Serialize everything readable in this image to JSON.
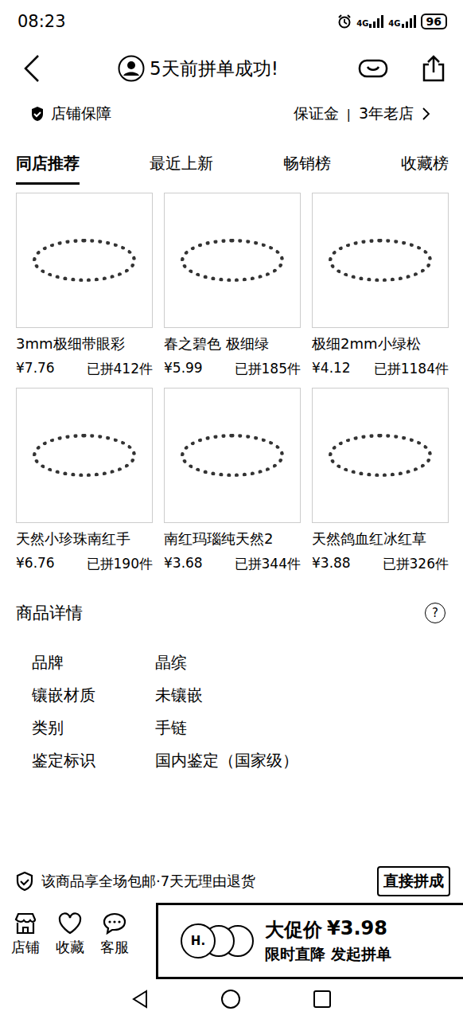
{
  "status_bar": {
    "time": "08:23",
    "network": [
      "4G",
      "4G"
    ],
    "battery": "96"
  },
  "header": {
    "title": "5天前拼单成功!"
  },
  "shop": {
    "guarantee": "店铺保障",
    "deposit": "保证金",
    "separator": "|",
    "age": "3年老店"
  },
  "tabs": [
    {
      "label": "同店推荐",
      "selected": true
    },
    {
      "label": "最近上新",
      "selected": false
    },
    {
      "label": "畅销榜",
      "selected": false
    },
    {
      "label": "收藏榜",
      "selected": false
    }
  ],
  "products": [
    {
      "title": "3mm极细带眼彩",
      "price": "¥7.76",
      "sold": "已拼412件"
    },
    {
      "title": "春之碧色 极细绿",
      "price": "¥5.99",
      "sold": "已拼185件"
    },
    {
      "title": "极细2mm小绿松",
      "price": "¥4.12",
      "sold": "已拼1184件"
    },
    {
      "title": "天然小珍珠南红手",
      "price": "¥6.76",
      "sold": "已拼190件"
    },
    {
      "title": "南红玛瑙纯天然2",
      "price": "¥3.68",
      "sold": "已拼344件"
    },
    {
      "title": "天然鸽血红冰红草",
      "price": "¥3.88",
      "sold": "已拼326件"
    }
  ],
  "details": {
    "title": "商品详情",
    "help": "?",
    "rows": [
      {
        "label": "品牌",
        "value": "晶缤"
      },
      {
        "label": "镶嵌材质",
        "value": "未镶嵌"
      },
      {
        "label": "类别",
        "value": "手链"
      },
      {
        "label": "鉴定标识",
        "value": "国内鉴定（国家级）"
      }
    ]
  },
  "notice": {
    "text": "该商品享全场包邮·7天无理由退货",
    "button": "直接拼成"
  },
  "bottom_bar": {
    "actions": [
      {
        "label": "店铺"
      },
      {
        "label": "收藏"
      },
      {
        "label": "客服"
      }
    ],
    "promo": {
      "logo": "H.",
      "price_label": "大促价",
      "price": "¥3.98",
      "subtitle": "限时直降 发起拼单"
    }
  }
}
